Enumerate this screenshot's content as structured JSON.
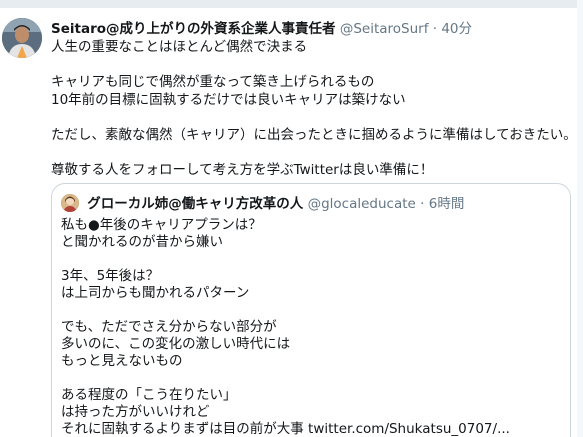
{
  "tweet": {
    "display_name": "Seitaro@成り上がりの外資系企業人事責任者",
    "handle": "@SeitaroSurf",
    "separator": "·",
    "time": "40分",
    "lines": [
      "人生の重要なことはほとんど偶然で決まる",
      "キャリアも同じで偶然が重なって築き上げられるもの",
      "10年前の目標に固執するだけでは良いキャリアは築けない",
      "ただし、素敵な偶然（キャリア）に出会ったときに掴めるように準備はしておきたい。",
      "尊敬する人をフォローして考え方を学ぶTwitterは良い準備に！"
    ]
  },
  "quote": {
    "display_name": "グローカル姉@働キャリ方改革の人",
    "handle": "@glocaleducate",
    "separator": "·",
    "time": "6時間",
    "lines": [
      "私も●年後のキャリアプランは？",
      "と聞かれるのが昔から嫌い",
      "3年、5年後は？",
      "は上司からも聞かれるパターン",
      "でも、ただでさえ分からない部分が",
      "多いのに、この変化の激しい時代には",
      "もっと見えないもの",
      "ある程度の「こう在りたい」",
      "は持った方がいいけれど",
      "それに固執するよりまずは目の前が大事"
    ],
    "link": "twitter.com/Shukatsu_0707/..."
  }
}
